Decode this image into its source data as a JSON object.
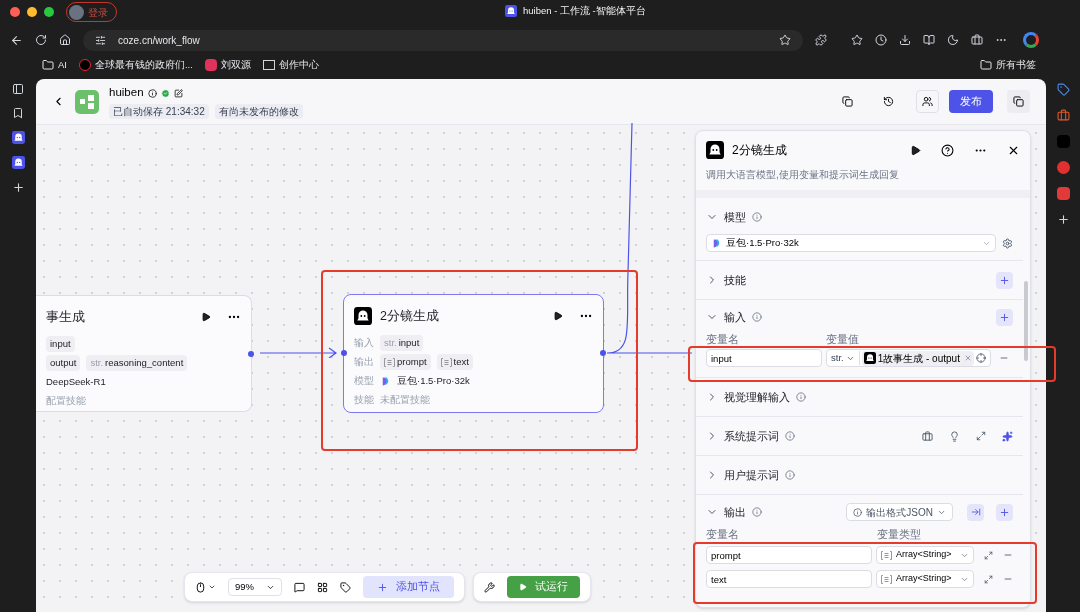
{
  "browser": {
    "tab_title": "huiben - 工作流 -智能体平台",
    "profile_label": "登录",
    "url": "coze.cn/work_flow",
    "bookmarks": [
      {
        "kind": "folder",
        "label": "AI"
      },
      {
        "kind": "tiktok",
        "label": "全球最有钱的政府们..."
      },
      {
        "kind": "app",
        "label": "刘双源"
      },
      {
        "kind": "studio",
        "label": "创作中心"
      }
    ],
    "all_bookmarks": "所有书签"
  },
  "header": {
    "name": "huiben",
    "saved_tag": "已自动保存 21:34:32",
    "unpublished_tag": "有尚未发布的修改",
    "publish_button": "发布"
  },
  "nodes": [
    {
      "title": "事生成",
      "selected": false,
      "rows": [
        {
          "label": "",
          "tags": [
            {
              "kind": "plain",
              "name": "input"
            }
          ]
        },
        {
          "label": "",
          "tags": [
            {
              "kind": "plain",
              "name": "output"
            },
            {
              "kind": "str",
              "prefix": "str.",
              "name": "reasoning_content"
            }
          ]
        },
        {
          "label": "",
          "text": "DeepSeek-R1",
          "muted": false
        },
        {
          "label": "",
          "text": "配置技能",
          "muted": true
        }
      ]
    },
    {
      "title": "2分镜生成",
      "selected": true,
      "rows": [
        {
          "label": "输入",
          "tags": [
            {
              "kind": "str",
              "prefix": "str.",
              "name": "input"
            }
          ]
        },
        {
          "label": "输出",
          "tags": [
            {
              "kind": "array",
              "name": "prompt"
            },
            {
              "kind": "array",
              "name": "text"
            }
          ]
        },
        {
          "label": "模型",
          "text": "豆包·1.5·Pro·32k",
          "muted": false,
          "model_icon": true
        },
        {
          "label": "技能",
          "text": "未配置技能",
          "muted": true
        }
      ]
    }
  ],
  "panel": {
    "title": "2分镜生成",
    "description": "调用大语言模型,使用变量和提示词生成回复",
    "sections": [
      {
        "kind": "model",
        "title": "模型",
        "expanded": true,
        "info": true,
        "value": "豆包·1.5·Pro·32k"
      },
      {
        "kind": "plain",
        "title": "技能",
        "expanded": false,
        "info": false,
        "add": true
      },
      {
        "kind": "inputs",
        "title": "输入",
        "expanded": true,
        "info": true,
        "add": true,
        "columns": [
          "变量名",
          "变量值"
        ],
        "rows": [
          {
            "name": "input",
            "type": "str.",
            "ref": "1故事生成 - output"
          }
        ]
      },
      {
        "kind": "plain",
        "title": "视觉理解输入",
        "expanded": false,
        "info": true,
        "add": false
      },
      {
        "kind": "prompt",
        "title": "系统提示词",
        "expanded": false,
        "info": true
      },
      {
        "kind": "plain",
        "title": "用户提示词",
        "expanded": false,
        "info": true,
        "add": false
      },
      {
        "kind": "outputs",
        "title": "输出",
        "expanded": true,
        "info": true,
        "add": true,
        "format": "输出格式JSON",
        "columns": [
          "变量名",
          "变量类型"
        ],
        "rows": [
          {
            "name": "prompt",
            "type": "Array<String>"
          },
          {
            "name": "text",
            "type": "Array<String>"
          }
        ]
      }
    ]
  },
  "toolbar": {
    "zoom": "99%",
    "add_node": "添加节点",
    "run": "试运行"
  }
}
